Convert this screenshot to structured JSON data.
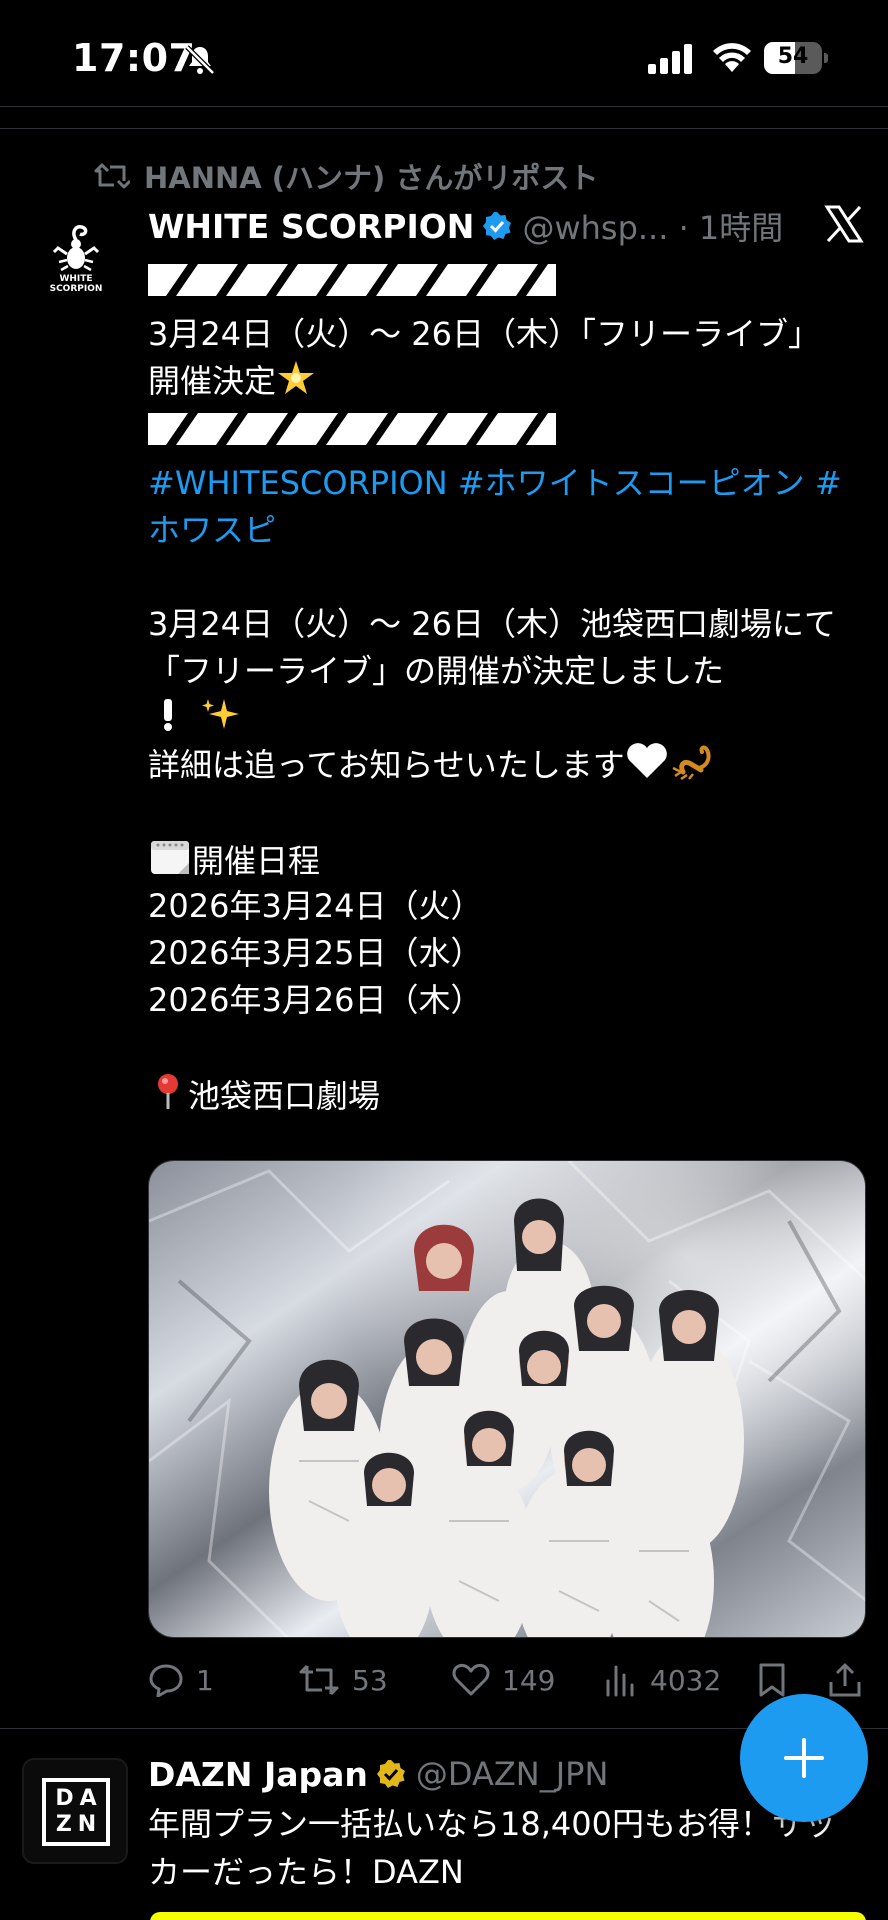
{
  "status_bar": {
    "time": "17:07",
    "battery_level": "54",
    "battery_fraction": 0.54
  },
  "repost": {
    "text": "HANNA (ハンナ) さんがリポスト",
    "icon": "repost-icon"
  },
  "tweet": {
    "display_name": "WHITE SCORPION",
    "handle_time": "@whsp... · 1時間",
    "avatar_text_line1": "WHITE",
    "avatar_text_line2": "SCORPION",
    "lines": {
      "l1": "3月24日（火）～ 26日（木）「フリーライブ」",
      "l2": "開催決定",
      "hashtags": "#WHITESCORPION #ホワイトスコーピオン #ホワスピ",
      "p1": "3月24日（火）～ 26日（木）池袋西口劇場にて「フリーライブ」の開催が決定しました",
      "p2": "詳細は追ってお知らせいたします",
      "schedule_label": "開催日程",
      "date1": "2026年3月24日（火）",
      "date2": "2026年3月25日（水）",
      "date3": "2026年3月26日（木）",
      "venue": "池袋西口劇場"
    },
    "stats": {
      "replies": "1",
      "reposts": "53",
      "likes": "149",
      "views": "4032"
    }
  },
  "tweet2": {
    "display_name": "DAZN Japan",
    "handle": "@DAZN_JPN",
    "avatar_text": "DAZN",
    "text": "年間プラン一括払いなら18,400円もお得！サッカーだったら！DAZN"
  },
  "colors": {
    "background": "#000000",
    "accent": "#1d9bf0",
    "muted": "#71767b",
    "gold": "#e2b719",
    "ad_yellow": "#f6ff00"
  }
}
